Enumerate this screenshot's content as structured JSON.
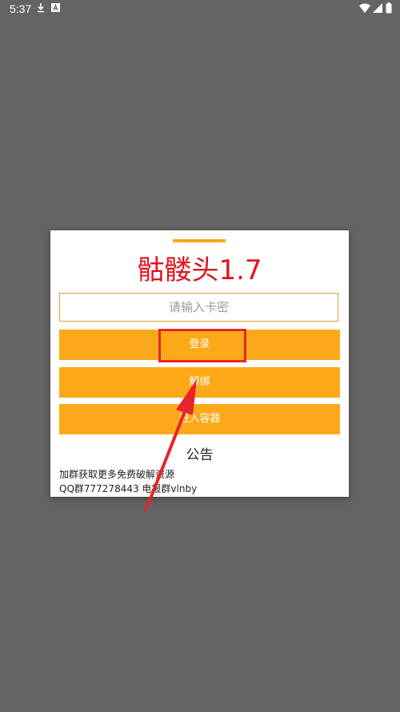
{
  "status_bar": {
    "time": "5:37",
    "icons": [
      "download-icon",
      "font-a-icon",
      "wifi-icon",
      "signal-icon",
      "battery-icon"
    ]
  },
  "dialog": {
    "title": "骷髅头1.7",
    "input_placeholder": "请输入卡密",
    "buttons": {
      "login": "登录",
      "unbind": "解绑",
      "enter_container": "进入容器"
    },
    "notice": {
      "title": "公告",
      "lines": [
        "加群获取更多免费破解资源",
        "QQ群777278443  电报群vlnby"
      ]
    }
  },
  "colors": {
    "background": "#646464",
    "accent_orange": "#FBA918",
    "title_red": "#E0141E",
    "annotation_red": "#E8232B"
  }
}
